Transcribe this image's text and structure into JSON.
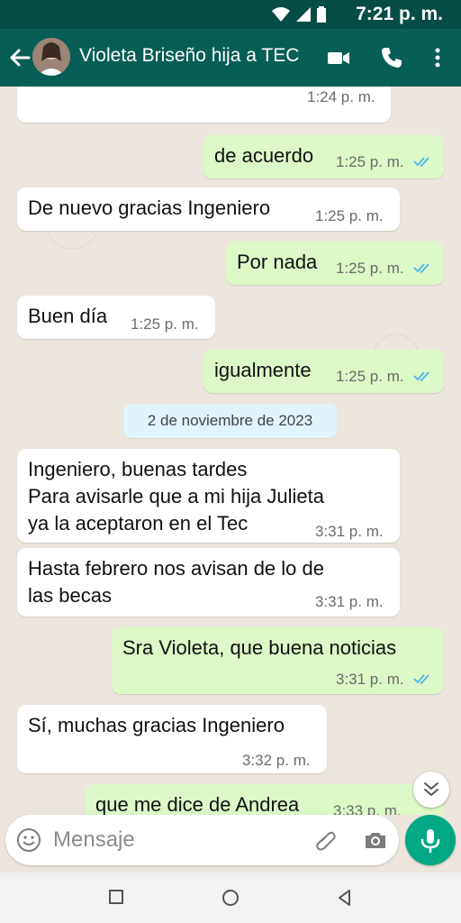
{
  "status_bar": {
    "time": "7:21 p. m."
  },
  "header": {
    "contact_name": "Violeta Briseño hija a TEC"
  },
  "messages": [
    {
      "direction": "in",
      "text": "",
      "time": "1:24 p. m."
    },
    {
      "direction": "out",
      "text": "de acuerdo",
      "time": "1:25 p. m.",
      "read": true
    },
    {
      "direction": "in",
      "text": "De nuevo gracias Ingeniero",
      "time": "1:25 p. m."
    },
    {
      "direction": "out",
      "text": "Por nada",
      "time": "1:25 p. m.",
      "read": true
    },
    {
      "direction": "in",
      "text": "Buen día",
      "time": "1:25 p. m."
    },
    {
      "direction": "out",
      "text": "igualmente",
      "time": "1:25 p. m.",
      "read": true
    },
    {
      "direction": "in",
      "text": "Ingeniero, buenas tardes\nPara avisarle que a mi hija Julieta\nya la aceptaron en el Tec",
      "time": "3:31 p. m."
    },
    {
      "direction": "in",
      "text": "Hasta febrero nos avisan de lo de\nlas becas",
      "time": "3:31 p. m."
    },
    {
      "direction": "out",
      "text": "Sra Violeta, que buena noticias",
      "time": "3:31 p. m.",
      "read": true
    },
    {
      "direction": "in",
      "text": "Sí, muchas gracias Ingeniero",
      "time": "3:32 p. m."
    },
    {
      "direction": "out",
      "text": "que me dice de Andrea",
      "time": "3:33 p. m."
    }
  ],
  "date_separator": "2 de noviembre de 2023",
  "composer": {
    "placeholder": "Mensaje"
  },
  "colors": {
    "header": "#075e54",
    "status_bar": "#054d44",
    "outgoing_bubble": "#dcf8c6",
    "incoming_bubble": "#ffffff",
    "read_tick": "#4fb6ec",
    "fab": "#00a884",
    "chat_bg": "#ece5dd"
  }
}
